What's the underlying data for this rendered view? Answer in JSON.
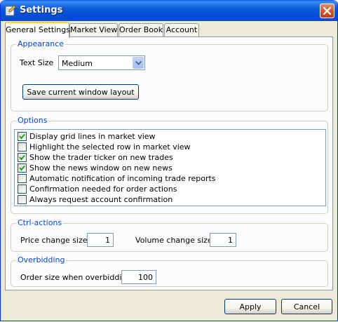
{
  "window": {
    "title": "Settings"
  },
  "tabs": [
    {
      "label": "General Settings",
      "active": true
    },
    {
      "label": "Market View",
      "active": false
    },
    {
      "label": "Order Book",
      "active": false
    },
    {
      "label": "Account",
      "active": false
    }
  ],
  "appearance": {
    "group_label": "Appearance",
    "text_size_label": "Text Size",
    "text_size_value": "Medium",
    "save_layout_label": "Save current window layout"
  },
  "options": {
    "group_label": "Options",
    "items": [
      {
        "label": "Display grid lines in market view",
        "checked": true
      },
      {
        "label": "Highlight the selected row in market view",
        "checked": false
      },
      {
        "label": "Show the trader ticker on new trades",
        "checked": true
      },
      {
        "label": "Show the news window on new news",
        "checked": true
      },
      {
        "label": "Automatic notification of incoming trade reports",
        "checked": false
      },
      {
        "label": "Confirmation needed for order actions",
        "checked": false
      },
      {
        "label": "Always request account confirmation",
        "checked": false
      }
    ]
  },
  "ctrl_actions": {
    "group_label": "Ctrl-actions",
    "price_change_label": "Price change size",
    "price_change_value": "1",
    "volume_change_label": "Volume change size",
    "volume_change_value": "1"
  },
  "overbidding": {
    "group_label": "Overbidding",
    "order_size_label": "Order size when overbidding",
    "order_size_value": "100"
  },
  "buttons": {
    "apply": "Apply",
    "cancel": "Cancel"
  },
  "colors": {
    "titlebar": "#0a5fe6",
    "group_label": "#0046d5",
    "check": "#21a121",
    "close_button": "#d4582f",
    "active_tab_border": "#ffc83c"
  }
}
